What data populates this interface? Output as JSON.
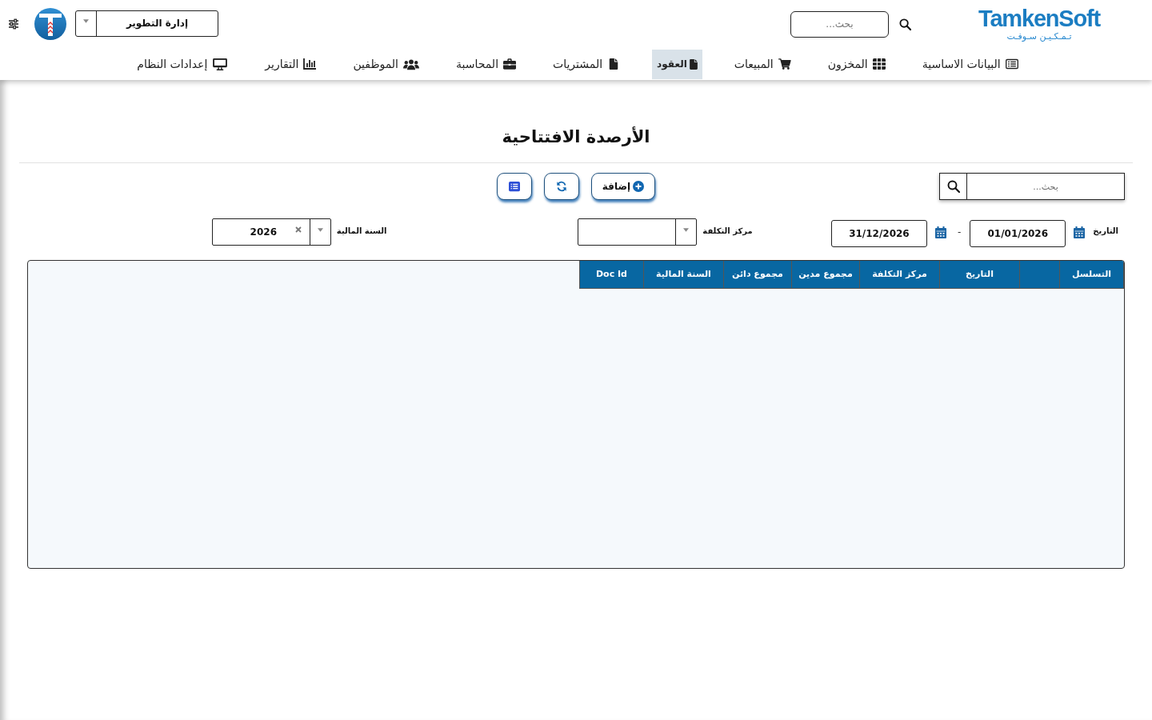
{
  "header": {
    "logo": {
      "wordmark": "TamkenSoft",
      "tagline": "تـمـكـيـن سـوفـت"
    },
    "search": {
      "placeholder": "بحث..."
    },
    "department": {
      "value": "إدارة التطوير"
    }
  },
  "nav": [
    {
      "label": "البيانات الاساسية",
      "selected": false
    },
    {
      "label": "المخزون",
      "selected": false
    },
    {
      "label": "المبيعات",
      "selected": false
    },
    {
      "label": "العقود",
      "selected": true
    },
    {
      "label": "المشتريات",
      "selected": false
    },
    {
      "label": "المحاسبة",
      "selected": false
    },
    {
      "label": "الموظفين",
      "selected": false
    },
    {
      "label": "التقارير",
      "selected": false
    },
    {
      "label": "إعدادات النظام",
      "selected": false
    }
  ],
  "page": {
    "title": "الأرصدة الافتتاحية"
  },
  "toolbar": {
    "search": {
      "placeholder": "بحث..."
    },
    "buttons": [
      {
        "kind": "add",
        "label": "إضافة"
      },
      {
        "kind": "refresh"
      },
      {
        "kind": "list"
      }
    ]
  },
  "filters": {
    "date": {
      "label": "التاريخ",
      "from": "01/01/2026",
      "separator": "-",
      "to": "31/12/2026"
    },
    "cost_center": {
      "label": "مركز التكلفة"
    },
    "fiscal_year": {
      "label": "السنة المالية",
      "value": "2026"
    }
  },
  "table": {
    "columns": [
      {
        "label": "التسلسل"
      },
      {},
      {
        "label": "التاريخ"
      },
      {
        "label": "مركز التكلفة"
      },
      {
        "label": "مجموع مدين"
      },
      {
        "label": "مجموع دائن"
      },
      {
        "label": "السنة المالية"
      },
      {
        "label": "Doc Id"
      }
    ]
  }
}
